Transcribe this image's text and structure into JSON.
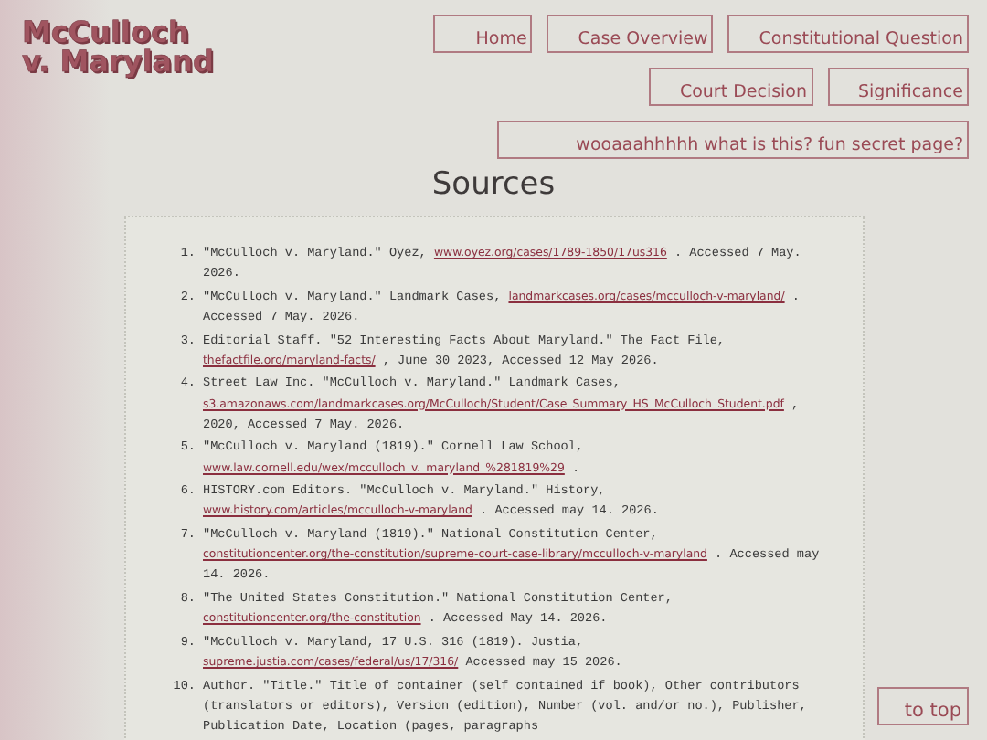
{
  "site_title": [
    "McCulloch",
    "v. Maryland"
  ],
  "nav": [
    [
      "Home",
      "Case Overview",
      "Constitutional Question"
    ],
    [
      "Court Decision",
      "Significance"
    ],
    [
      "wooaaahhhhh what is this? fun secret page?"
    ]
  ],
  "heading": "Sources",
  "sources": [
    {
      "number": "1.",
      "text": "\"McCulloch v. Maryland.\" Oyez, ",
      "link": "www.oyez.org/cases/1789-1850/17us316",
      "after": " . Accessed 7 May. 2026."
    },
    {
      "number": "2.",
      "text": "\"McCulloch v. Maryland.\" Landmark Cases, ",
      "link": "landmarkcases.org/cases/mcculloch-v-maryland/",
      "after": " . Accessed 7 May. 2026."
    },
    {
      "number": "3.",
      "text": "Editorial Staff. \"52 Interesting Facts About Maryland.\" The Fact File, ",
      "link": "thefactfile.org/maryland-facts/",
      "after": " , June 30 2023, Accessed 12 May 2026."
    },
    {
      "number": "4.",
      "text": "Street Law Inc. \"McCulloch v. Maryland.\" Landmark Cases, ",
      "link": "s3.amazonaws.com/landmarkcases.org/McCulloch/Student/Case_Summary_HS_McCulloch_Student.pdf",
      "after": " , 2020, Accessed 7 May. 2026."
    },
    {
      "number": "5.",
      "text": "\"McCulloch v. Maryland (1819).\" Cornell Law School, ",
      "link": "www.law.cornell.edu/wex/mcculloch_v._maryland_%281819%29",
      "after": " ."
    },
    {
      "number": "6.",
      "text": "HISTORY.com Editors. \"McCulloch v. Maryland.\" History, ",
      "link": "www.history.com/articles/mcculloch-v-maryland",
      "after": " . Accessed may 14. 2026."
    },
    {
      "number": "7.",
      "text": "\"McCulloch v. Maryland (1819).\" National Constitution Center, ",
      "link": "constitutioncenter.org/the-constitution/supreme-court-case-library/mcculloch-v-maryland",
      "after": " . Accessed may 14. 2026."
    },
    {
      "number": "8.",
      "text": "\"The United States Constitution.\" National Constitution Center, ",
      "link": "constitutioncenter.org/the-constitution",
      "after": " . Accessed May 14. 2026."
    },
    {
      "number": "9.",
      "text": "\"McCulloch v. Maryland, 17 U.S. 316 (1819). Justia, ",
      "link": "supreme.justia.com/cases/federal/us/17/316/",
      "after": "  Accessed may 15 2026."
    },
    {
      "number": "10.",
      "text": "Author. \"Title.\" Title of container (self contained if book), Other contributors (translators or editors), Version (edition), Number (vol. and/or no.), Publisher, Publication Date, Location (pages, paragraphs"
    }
  ],
  "to_top": "to top"
}
